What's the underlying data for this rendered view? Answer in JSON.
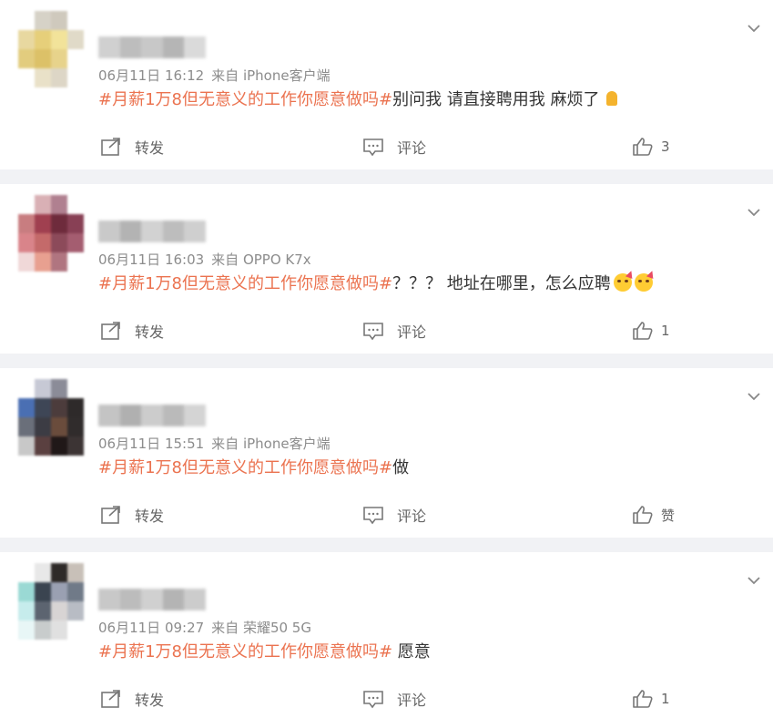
{
  "posts": [
    {
      "time": "06月11日 16:12",
      "source": "来自 iPhone客户端",
      "hashtag": "#月薪1万8但无意义的工作你愿意做吗#",
      "text": "别问我 请直接聘用我 麻烦了",
      "emoji": [
        "folded-hands"
      ],
      "repost_label": "转发",
      "comment_label": "评论",
      "like_count": "3",
      "avatar_colors": [
        "#ffffff",
        "#d6d2c7",
        "#cfc9bd",
        "#ffffff",
        "#e8d8a0",
        "#e6cf7a",
        "#f2e39a",
        "#e0dac8",
        "#e2cc7e",
        "#dcc168",
        "#e7d38b",
        "#ffffff",
        "#ffffff",
        "#e9e1c8",
        "#ddd6c6",
        "#ffffff"
      ],
      "name_colors": [
        "#d0d0d0",
        "#bdbdbd",
        "#c8c8c8",
        "#b5b5b5",
        "#dadada"
      ]
    },
    {
      "time": "06月11日 16:03",
      "source": "来自 OPPO K7x",
      "hashtag": "#月薪1万8但无意义的工作你愿意做吗#",
      "text": "？？？ 地址在哪里，怎么应聘",
      "emoji": [
        "party-face",
        "party-face"
      ],
      "repost_label": "转发",
      "comment_label": "评论",
      "like_count": "1",
      "avatar_colors": [
        "#ffffff",
        "#d9b0b5",
        "#b08090",
        "#ffffff",
        "#c87d80",
        "#a04050",
        "#6e2b3c",
        "#884055",
        "#d9848a",
        "#c46a6a",
        "#8c4a5a",
        "#a45d70",
        "#f0d8d8",
        "#e8a090",
        "#b07580",
        "#ffffff"
      ],
      "name_colors": [
        "#c9c9c9",
        "#b3b3b3",
        "#d2d2d2",
        "#bdbdbd",
        "#cfcfcf"
      ]
    },
    {
      "time": "06月11日 15:51",
      "source": "来自 iPhone客户端",
      "hashtag": "#月薪1万8但无意义的工作你愿意做吗#",
      "text": "做",
      "emoji": [],
      "repost_label": "转发",
      "comment_label": "评论",
      "like_count": "赞",
      "avatar_colors": [
        "#ffffff",
        "#c7c9d5",
        "#8b8c98",
        "#ffffff",
        "#4a6fb3",
        "#3e4656",
        "#4c3c3c",
        "#2e2a2a",
        "#6a6f7a",
        "#3c3c44",
        "#6a4c3c",
        "#302c2c",
        "#c8c8c8",
        "#5a4040",
        "#201818",
        "#3c3434"
      ],
      "name_colors": [
        "#c4c4c4",
        "#b0b0b0",
        "#cccccc",
        "#bababa",
        "#d4d4d4"
      ]
    },
    {
      "time": "06月11日 09:27",
      "source": "来自 荣耀50 5G",
      "hashtag": "#月薪1万8但无意义的工作你愿意做吗#",
      "text": " 愿意",
      "emoji": [],
      "repost_label": "转发",
      "comment_label": "评论",
      "like_count": "1",
      "avatar_colors": [
        "#ffffff",
        "#e8e8e8",
        "#2e2a28",
        "#c8c0b8",
        "#9ad9d4",
        "#3a4450",
        "#9aa0b2",
        "#707a88",
        "#c6ecec",
        "#5c6470",
        "#d8d4d4",
        "#b8bcc4",
        "#e8f6f6",
        "#c8cccc",
        "#e0e0e0",
        "#ffffff"
      ],
      "name_colors": [
        "#c8c8c8",
        "#bcbcbc",
        "#d0d0d0",
        "#b4b4b4",
        "#cccccc"
      ]
    }
  ]
}
